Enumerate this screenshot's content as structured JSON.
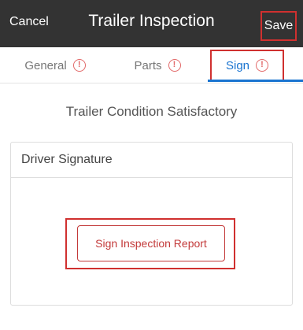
{
  "header": {
    "cancel_label": "Cancel",
    "title": "Trailer Inspection",
    "save_label": "Save"
  },
  "tabs": [
    {
      "label": "General",
      "icon": "alert-circle-icon",
      "active": false
    },
    {
      "label": "Parts",
      "icon": "alert-circle-icon",
      "active": false
    },
    {
      "label": "Sign",
      "icon": "alert-circle-icon",
      "active": true
    }
  ],
  "alert_glyph": "!",
  "main": {
    "condition_text": "Trailer Condition Satisfactory",
    "signature_card": {
      "title": "Driver Signature",
      "button_label": "Sign Inspection Report"
    }
  },
  "colors": {
    "header_bg": "#333333",
    "active_tab": "#1a74d0",
    "alert": "#e26a6a",
    "highlight": "#d0302f",
    "button": "#c33a3a"
  }
}
